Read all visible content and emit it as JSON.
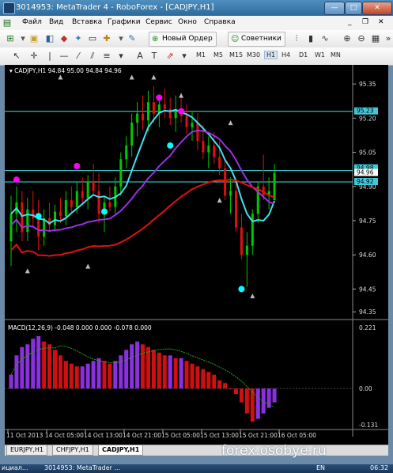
{
  "window": {
    "title": "3014953: MetaTrader 4 - RoboForex - [CADJPY,H1]",
    "min_label": "—",
    "max_label": "□",
    "close_label": "✕"
  },
  "menu": {
    "items": [
      "Файл",
      "Вид",
      "Вставка",
      "Графики",
      "Сервис",
      "Окно",
      "Справка"
    ]
  },
  "toolbar": {
    "new_order_label": "Новый Ордер",
    "advisors_label": "Советники"
  },
  "timeframes": [
    "M1",
    "M5",
    "M15",
    "M30",
    "H1",
    "H4",
    "D1",
    "W1",
    "MN"
  ],
  "active_timeframe": "H1",
  "chart": {
    "header": "CADJPY,H1  94.84 95.00 94.84 94.96",
    "price_ticks": [
      "95.35",
      "95.20",
      "95.05",
      "94.90",
      "94.75",
      "94.60",
      "94.45",
      "94.35"
    ],
    "price_badges": [
      "95.23",
      "94.98",
      "94.96",
      "94.92"
    ],
    "time_labels": [
      "11 Oct 2013",
      "14 Oct 05:00",
      "14 Oct 13:00",
      "14 Oct 21:00",
      "15 Oct 05:00",
      "15 Oct 13:00",
      "15 Oct 21:00",
      "16 Oct 05:00"
    ],
    "macd_header": "MACD(12,26,9) -0.048 0.000 0.000 -0.078 0.000",
    "macd_ticks": [
      "0.221",
      "0.00",
      "-0.131"
    ],
    "colors": {
      "bull": "#00c800",
      "bear": "#e01010",
      "ma_fast": "#40e0f0",
      "ma_mid": "#9a30e0",
      "ma_slow": "#e01010",
      "hline": "#40e0e0",
      "dots": [
        "#ff00ff",
        "#00ffff"
      ]
    }
  },
  "chart_data": {
    "type": "candlestick",
    "symbol": "CADJPY",
    "timeframe": "H1",
    "ylim": [
      94.33,
      95.42
    ],
    "ohlc": [
      [
        94.66,
        94.86,
        94.55,
        94.78
      ],
      [
        94.78,
        94.9,
        94.7,
        94.83
      ],
      [
        94.83,
        94.88,
        94.66,
        94.7
      ],
      [
        94.7,
        94.85,
        94.66,
        94.8
      ],
      [
        94.8,
        94.88,
        94.72,
        94.76
      ],
      [
        94.76,
        94.84,
        94.62,
        94.68
      ],
      [
        94.68,
        94.8,
        94.64,
        94.76
      ],
      [
        94.76,
        94.83,
        94.7,
        94.73
      ],
      [
        94.73,
        94.82,
        94.7,
        94.79
      ],
      [
        94.79,
        94.85,
        94.74,
        94.77
      ],
      [
        94.77,
        94.88,
        94.73,
        94.84
      ],
      [
        94.84,
        94.9,
        94.79,
        94.81
      ],
      [
        94.81,
        94.92,
        94.78,
        94.88
      ],
      [
        94.88,
        94.94,
        94.82,
        94.85
      ],
      [
        94.85,
        94.95,
        94.8,
        94.92
      ],
      [
        94.92,
        95.0,
        94.86,
        94.88
      ],
      [
        94.88,
        94.96,
        94.74,
        94.78
      ],
      [
        94.78,
        94.86,
        94.7,
        94.83
      ],
      [
        94.83,
        94.9,
        94.79,
        94.81
      ],
      [
        94.81,
        94.94,
        94.78,
        94.9
      ],
      [
        94.9,
        95.05,
        94.86,
        95.02
      ],
      [
        95.02,
        95.12,
        94.98,
        95.08
      ],
      [
        95.08,
        95.22,
        95.03,
        95.18
      ],
      [
        95.18,
        95.27,
        95.12,
        95.22
      ],
      [
        95.22,
        95.3,
        95.15,
        95.19
      ],
      [
        95.19,
        95.32,
        95.14,
        95.27
      ],
      [
        95.27,
        95.34,
        95.18,
        95.22
      ],
      [
        95.22,
        95.3,
        95.16,
        95.26
      ],
      [
        95.26,
        95.33,
        95.2,
        95.24
      ],
      [
        95.24,
        95.29,
        95.17,
        95.2
      ],
      [
        95.2,
        95.3,
        95.14,
        95.23
      ],
      [
        95.23,
        95.31,
        95.18,
        95.21
      ],
      [
        95.21,
        95.26,
        95.13,
        95.16
      ],
      [
        95.16,
        95.23,
        95.1,
        95.18
      ],
      [
        95.18,
        95.22,
        95.06,
        95.1
      ],
      [
        95.1,
        95.17,
        95.02,
        95.05
      ],
      [
        95.05,
        95.12,
        94.98,
        95.08
      ],
      [
        95.08,
        95.14,
        95.0,
        95.03
      ],
      [
        95.03,
        95.1,
        94.95,
        94.98
      ],
      [
        94.98,
        95.02,
        94.84,
        94.86
      ],
      [
        94.86,
        94.94,
        94.78,
        94.88
      ],
      [
        94.88,
        94.92,
        94.7,
        94.72
      ],
      [
        94.72,
        94.78,
        94.58,
        94.6
      ],
      [
        94.6,
        94.7,
        94.46,
        94.64
      ],
      [
        94.64,
        94.8,
        94.6,
        94.78
      ],
      [
        94.78,
        94.92,
        94.74,
        94.9
      ],
      [
        94.9,
        95.04,
        94.84,
        94.86
      ],
      [
        94.86,
        94.94,
        94.8,
        94.88
      ],
      [
        94.84,
        95.0,
        94.84,
        94.96
      ]
    ],
    "macd_hist": [
      0.05,
      0.12,
      0.15,
      0.16,
      0.18,
      0.19,
      0.17,
      0.16,
      0.14,
      0.12,
      0.1,
      0.09,
      0.08,
      0.08,
      0.09,
      0.1,
      0.11,
      0.1,
      0.09,
      0.1,
      0.12,
      0.14,
      0.16,
      0.17,
      0.16,
      0.15,
      0.14,
      0.13,
      0.12,
      0.12,
      0.11,
      0.11,
      0.1,
      0.09,
      0.08,
      0.07,
      0.06,
      0.05,
      0.03,
      0.02,
      0.0,
      -0.02,
      -0.05,
      -0.09,
      -0.12,
      -0.11,
      -0.09,
      -0.07,
      -0.05
    ]
  },
  "tabs": [
    "EURJPY,H1",
    "CHFJPY,H1",
    "CADJPY,H1"
  ],
  "active_tab": "CADJPY,H1",
  "watermark": "forex.osobye.ru",
  "taskbar": {
    "left": "ициал...",
    "app": "3014953: MetaTrader ...",
    "lang": "EN",
    "time": "06:32"
  }
}
